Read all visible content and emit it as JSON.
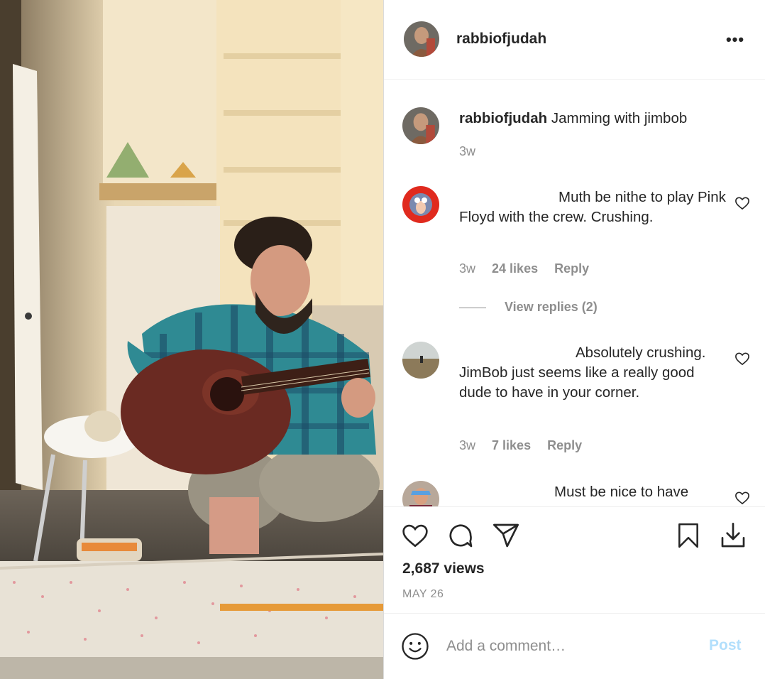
{
  "media": {
    "alt": "Man with beard in plaid shirt playing acoustic guitar in living room"
  },
  "post": {
    "username": "rabbiofjudah",
    "more_icon": "ellipsis-icon"
  },
  "caption": {
    "username": "rabbiofjudah",
    "text": "Jamming with jimbob",
    "time": "3w"
  },
  "comments": [
    {
      "text": "Muth be nithe to play Pink Floyd with the crew. Crushing.",
      "time": "3w",
      "likes": "24 likes",
      "reply": "Reply",
      "view_replies": "View replies (2)"
    },
    {
      "text": "Absolutely crushing. JimBob just seems like a really good dude to have in your corner.",
      "time": "3w",
      "likes": "7 likes",
      "reply": "Reply"
    },
    {
      "text": "Must be nice to have"
    }
  ],
  "actions": {
    "views": "2,687 views",
    "date": "MAY 26",
    "icons": [
      "heart-icon",
      "comment-icon",
      "share-icon",
      "bookmark-icon",
      "download-icon"
    ]
  },
  "add_comment": {
    "placeholder": "Add a comment…",
    "post_label": "Post"
  },
  "colors": {
    "text": "#262626",
    "muted": "#8e8e8e",
    "post_disabled": "#b2dffc",
    "divider": "#efefef"
  }
}
